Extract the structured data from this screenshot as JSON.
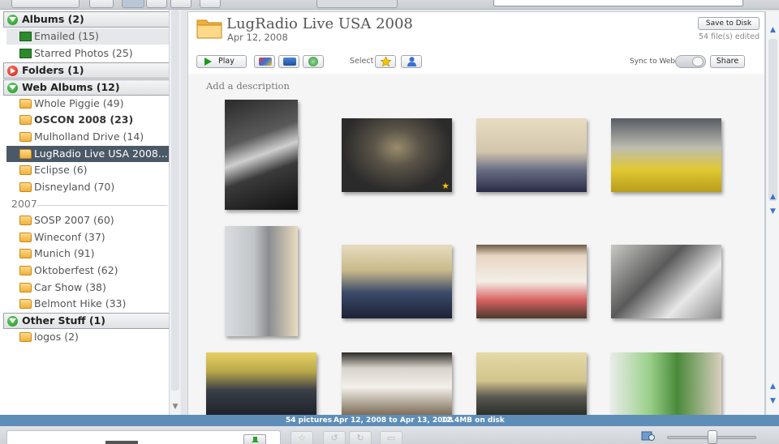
{
  "sidebar": {
    "sections": {
      "albums": "Albums (2)",
      "folders": "Folders (1)",
      "web_albums": "Web Albums (12)",
      "other": "Other Stuff (1)"
    },
    "albums": [
      "Emailed (15)",
      "Starred Photos (25)"
    ],
    "web_albums": [
      "Whole Piggie (49)",
      "OSCON 2008 (23)",
      "Mulholland Drive (14)",
      "LugRadio Live USA 2008...",
      "Eclipse (6)",
      "Disneyland (70)"
    ],
    "year": "2007",
    "year_albums": [
      "SOSP 2007 (60)",
      "Wineconf (37)",
      "Munich (91)",
      "Oktoberfest (62)",
      "Car Show (38)",
      "Belmont Hike (33)"
    ],
    "other_items": [
      "logos (2)"
    ]
  },
  "album": {
    "title": "LugRadio Live USA 2008",
    "date": "Apr 12, 2008",
    "save_label": "Save to Disk",
    "files_edited": "54 file(s) edited",
    "play_label": "Play",
    "select_label": "Select",
    "sync_label": "Sync to Web",
    "share_label": "Share",
    "description_placeholder": "Add a description"
  },
  "status": {
    "count": "54 pictures",
    "range": "Apr 12, 2008 to Apr 13, 2008",
    "disk": "12.4MB on disk"
  },
  "icons": {
    "albums_section": "green-chevron-icon",
    "folders_section": "red-play-icon",
    "album_item": "picture-album-icon",
    "folder_item": "folder-icon",
    "starred_photo": "star-icon"
  },
  "colors": {
    "selection": "#4b5967",
    "status_bar": "#5e8eb8",
    "star": "#f2c300"
  }
}
